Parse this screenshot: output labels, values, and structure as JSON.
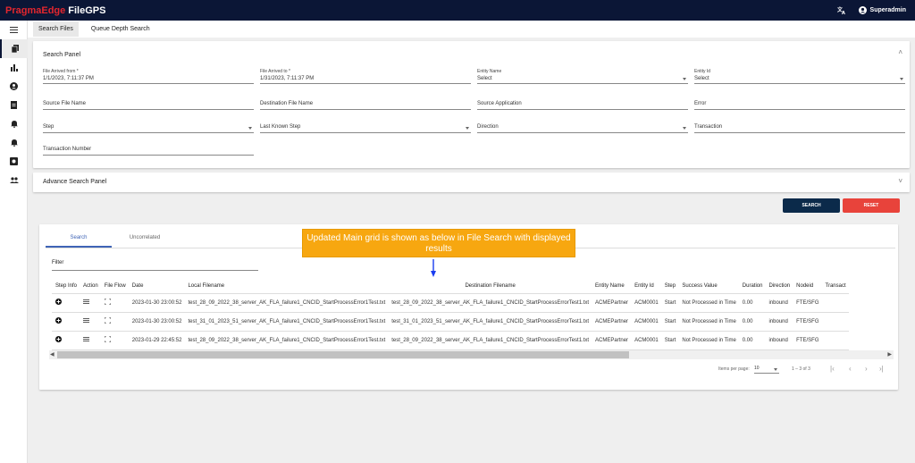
{
  "app": {
    "brand_part1": "PragmaEdge",
    "brand_part2": "FileGPS",
    "user": "Superadmin"
  },
  "colors": {
    "topbar": "#0b1636",
    "search_button": "#0b2a4a",
    "reset_button": "#e8433b",
    "callout": "#f7a710",
    "active_tab": "#3f64b6"
  },
  "sidebar": {
    "icons": [
      "menu-icon",
      "files-icon",
      "chart-icon",
      "account-icon",
      "document-icon",
      "bell-icon",
      "alarm-icon",
      "monitor-icon",
      "group-icon"
    ]
  },
  "tabs": [
    {
      "label": "Search Files"
    },
    {
      "label": "Queue Depth Search"
    }
  ],
  "search_panel": {
    "title": "Search Panel",
    "file_arrived_from_label": "File Arrived from *",
    "file_arrived_from_value": "1/1/2023, 7:11:37 PM",
    "file_arrived_to_label": "File Arrived to *",
    "file_arrived_to_value": "1/31/2023, 7:11:37 PM",
    "entity_name_label": "Entity Name",
    "entity_name_value": "Select",
    "entity_id_label": "Entity Id",
    "entity_id_value": "Select",
    "source_file_name": "Source File Name",
    "destination_file_name": "Destination File Name",
    "source_application": "Source Application",
    "error": "Error",
    "step": "Step",
    "last_known_step": "Last Known Step",
    "direction": "Direction",
    "transaction": "Transaction",
    "transaction_number": "Transaction Number"
  },
  "advance_panel": {
    "title": "Advance Search Panel"
  },
  "buttons": {
    "search": "SEARCH",
    "reset": "RESET"
  },
  "callout": {
    "text": "Updated Main grid is shown as below in File Search with displayed results"
  },
  "results": {
    "tabs": [
      "Search",
      "Uncorrelated"
    ],
    "filter_placeholder": "Filter",
    "columns": [
      "Step Info",
      "Action",
      "File Flow",
      "Date",
      "Local Filename",
      "Destination Filename",
      "Entity Name",
      "Entity Id",
      "Step",
      "Success Value",
      "Duration",
      "Direction",
      "Nodeid",
      "Transact"
    ],
    "rows": [
      {
        "date": "2023-01-30 23:00:52",
        "local": "test_28_09_2022_38_server_AK_FLA_failure1_CNCID_StartProcessError1Test.txt",
        "dest": "test_28_09_2022_38_server_AK_FLA_failure1_CNCID_StartProcessErrorTest1.txt",
        "entity_name": "ACMEPartner",
        "entity_id": "ACM0001",
        "step": "Start",
        "success": "Not Processed in Time",
        "duration": "0.00",
        "direction": "inbound",
        "nodeid": "FTE/SFG"
      },
      {
        "date": "2023-01-30 23:00:52",
        "local": "test_31_01_2023_51_server_AK_FLA_failure1_CNCID_StartProcessError1Test.txt",
        "dest": "test_31_01_2023_51_server_AK_FLA_failure1_CNCID_StartProcessErrorTest1.txt",
        "entity_name": "ACMEPartner",
        "entity_id": "ACM0001",
        "step": "Start",
        "success": "Not Processed in Time",
        "duration": "0.00",
        "direction": "inbound",
        "nodeid": "FTE/SFG"
      },
      {
        "date": "2023-01-29 22:45:52",
        "local": "test_28_09_2022_38_server_AK_FLA_failure1_CNCID_StartProcessError1Test.txt",
        "dest": "test_28_09_2022_38_server_AK_FLA_failure1_CNCID_StartProcessErrorTest1.txt",
        "entity_name": "ACMEPartner",
        "entity_id": "ACM0001",
        "step": "Start",
        "success": "Not Processed in Time",
        "duration": "0.00",
        "direction": "inbound",
        "nodeid": "FTE/SFG"
      }
    ]
  },
  "pagination": {
    "items_per_page_label": "Items per page:",
    "items_per_page_value": "10",
    "range": "1 – 3 of 3"
  }
}
